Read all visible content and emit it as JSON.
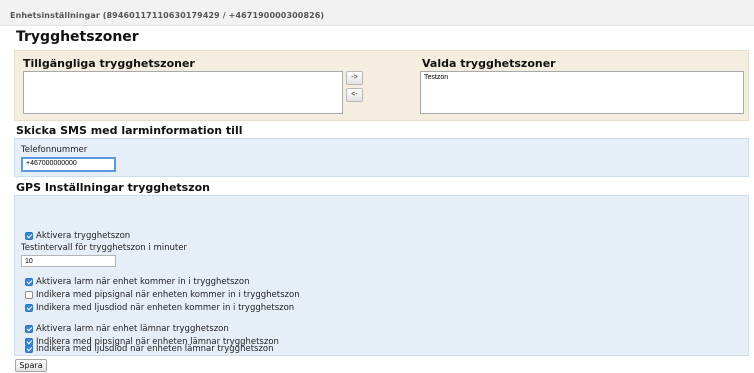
{
  "header": {
    "title": "Enhetsinställningar (89460117110630179429 / +467190000300826)"
  },
  "page_title": "Trygghetszoner",
  "zones": {
    "available_label": "Tillgängliga trygghetszoner",
    "available_items": [],
    "add_button": "->",
    "remove_button": "<-",
    "selected_label": "Valda trygghetszoner",
    "selected_items": [
      "Testzon"
    ]
  },
  "sms": {
    "section_title": "Skicka SMS med larminformation till",
    "phone_label": "Telefonnummer",
    "phone_value": "+467000000000"
  },
  "gps": {
    "section_title": "GPS Inställningar trygghetszon",
    "activate_label": "Aktivera trygghetszon",
    "interval_label": "Testintervall för trygghetszon i minuter",
    "interval_value": "10",
    "enter_alarm_label": "Aktivera larm när enhet kommer in i trygghetszon",
    "enter_beep_label": "Indikera med pipsignal när enheten kommer in i trygghetszon",
    "enter_led_label": "Indikera med ljusdiod när enheten kommer in i trygghetszon",
    "leave_alarm_label": "Aktivera larm när enhet lämnar trygghetszon",
    "leave_beep_label": "Indikera med pipsignal när enheten lämnar trygghetszon",
    "leave_led_label": "Indikera med ljusdiod när enheten lämnar trygghetszon",
    "checks": {
      "activate": true,
      "enter_alarm": true,
      "enter_beep": false,
      "enter_led": true,
      "leave_alarm": true,
      "leave_beep": true,
      "leave_led": true
    }
  },
  "save_button": "Spara",
  "colors": {
    "zones_panel_bg": "#f5eee0",
    "settings_panel_bg": "#e6eef8",
    "checkbox_on": "#3b86d8",
    "focus_ring": "#5b9ae0"
  }
}
